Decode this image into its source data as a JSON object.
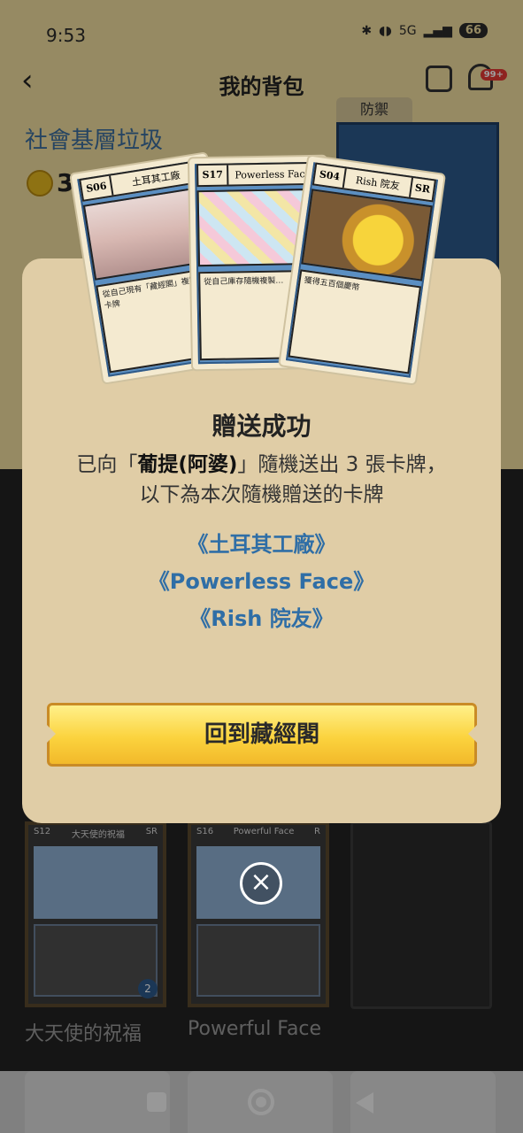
{
  "status_bar": {
    "time": "9:53",
    "battery": "66",
    "network": "5G"
  },
  "header": {
    "title": "我的背包",
    "badge": "99+"
  },
  "profile": {
    "name": "社會基層垃圾",
    "coins": "31"
  },
  "defense": {
    "label": "防禦"
  },
  "background_cards": [
    {
      "code": "S12",
      "name": "大天使的祝福",
      "rarity": "SR",
      "count": "2",
      "caption": "大天使的祝福"
    },
    {
      "code": "S16",
      "name": "Powerful Face",
      "rarity": "R",
      "caption": "Powerful Face"
    }
  ],
  "modal": {
    "title": "贈送成功",
    "message_prefix": "已向「",
    "recipient": "葡提(阿婆)",
    "message_suffix": "」隨機送出 3 張卡牌，",
    "message_line2": "以下為本次隨機贈送的卡牌",
    "sent_cards": [
      "《土耳其工廠》",
      "《Powerless Face》",
      "《Rish 院友》"
    ],
    "return_button": "回到藏經閣"
  },
  "fan_cards": [
    {
      "code": "S06",
      "name": "土耳其工廠",
      "text": "從自己現有「藏經閣」複製一張卡牌"
    },
    {
      "code": "S17",
      "name": "Powerless Face",
      "text": "從自己庫存隨機複製…"
    },
    {
      "code": "S04",
      "name": "Rish 院友",
      "rarity": "SR",
      "text": "獲得五百個慶幣"
    }
  ],
  "colors": {
    "accent": "#2f6ea6",
    "modal_bg": "#e0cda6",
    "button": "#fbd33e"
  }
}
